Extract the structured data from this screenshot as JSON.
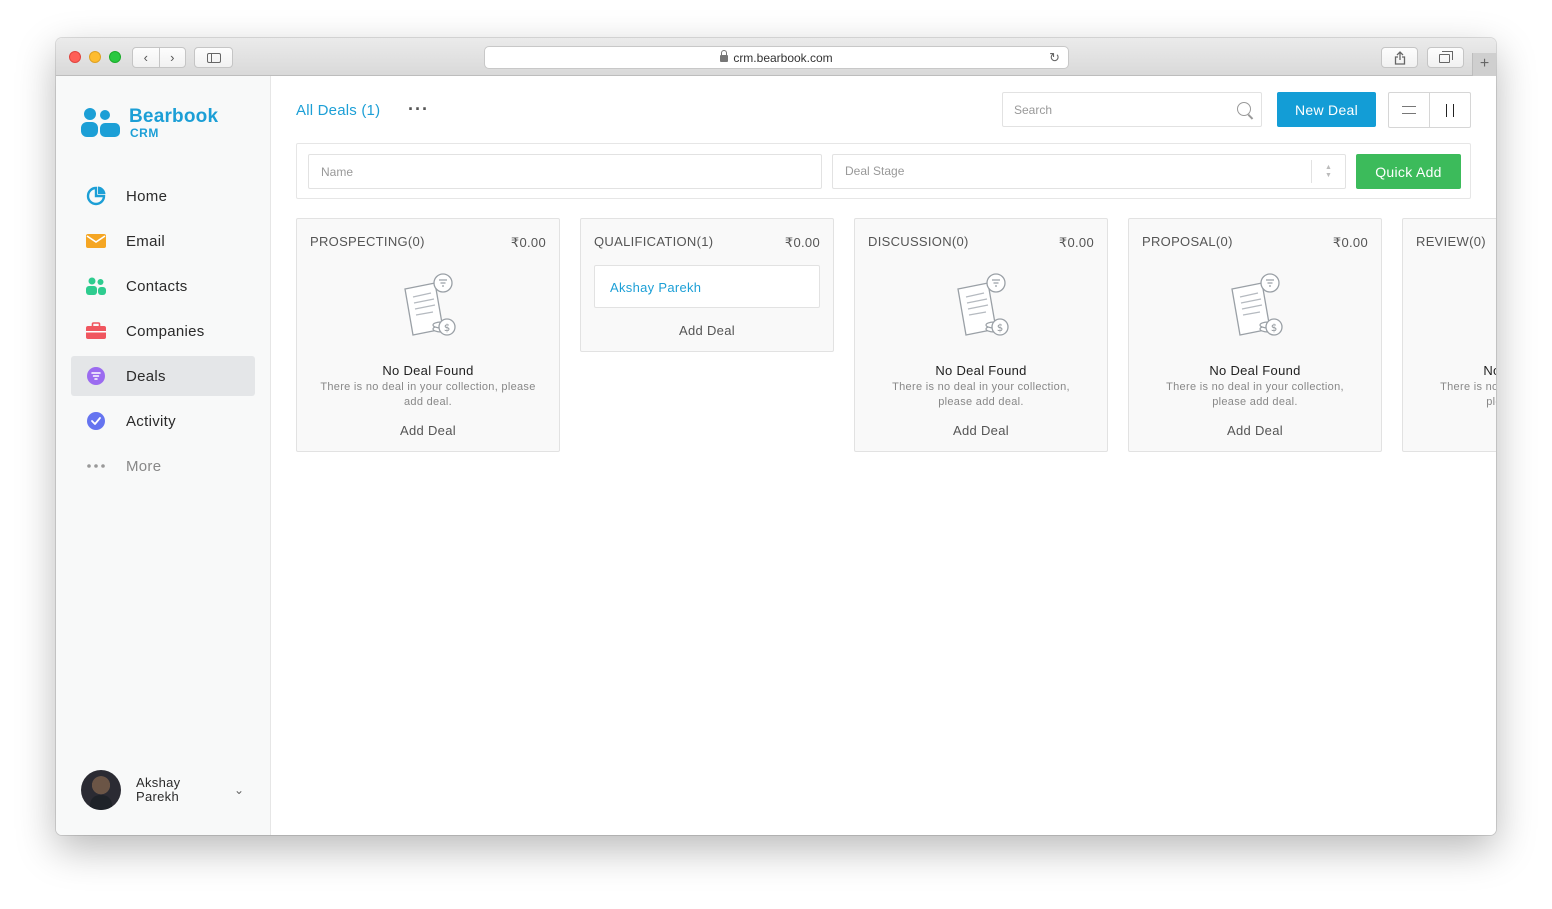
{
  "browser": {
    "url": "crm.bearbook.com"
  },
  "brand": {
    "name": "Bearbook",
    "sub": "CRM",
    "accent": "#1c9fd6"
  },
  "sidebar": {
    "items": [
      {
        "label": "Home",
        "icon": "pie-chart-icon",
        "color": "#1c9fd6"
      },
      {
        "label": "Email",
        "icon": "envelope-icon",
        "color": "#f5a623"
      },
      {
        "label": "Contacts",
        "icon": "contacts-icon",
        "color": "#2ecc8f"
      },
      {
        "label": "Companies",
        "icon": "briefcase-icon",
        "color": "#f0565f"
      },
      {
        "label": "Deals",
        "icon": "deals-filter-icon",
        "color": "#9b6bf0",
        "active": true
      },
      {
        "label": "Activity",
        "icon": "check-circle-icon",
        "color": "#6574f0"
      },
      {
        "label": "More",
        "icon": "more-dots-icon",
        "color": "#999999"
      }
    ],
    "user": {
      "name_line1": "Akshay",
      "name_line2": "Parekh"
    }
  },
  "header": {
    "title": "All Deals (1)",
    "search_placeholder": "Search",
    "new_deal_label": "New Deal"
  },
  "quick_add": {
    "name_placeholder": "Name",
    "stage_placeholder": "Deal Stage",
    "button_label": "Quick Add"
  },
  "pipeline": {
    "columns": [
      {
        "title": "PROSPECTING(0)",
        "amount": "₹0.00",
        "empty_title": "No Deal Found",
        "empty_desc": "There is no deal in your collection, please add deal.",
        "add_label": "Add Deal"
      },
      {
        "title": "QUALIFICATION(1)",
        "amount": "₹0.00",
        "deal": "Akshay Parekh",
        "add_label": "Add Deal"
      },
      {
        "title": "DISCUSSION(0)",
        "amount": "₹0.00",
        "empty_title": "No Deal Found",
        "empty_desc": "There is no deal in your collection, please add deal.",
        "add_label": "Add Deal"
      },
      {
        "title": "PROPOSAL(0)",
        "amount": "₹0.00",
        "empty_title": "No Deal Found",
        "empty_desc": "There is no deal in your collection, please add deal.",
        "add_label": "Add Deal"
      },
      {
        "title": "REVIEW(0)",
        "empty_title": "No Deal Found",
        "empty_desc": "There is no deal in your collection, please add deal."
      }
    ]
  }
}
